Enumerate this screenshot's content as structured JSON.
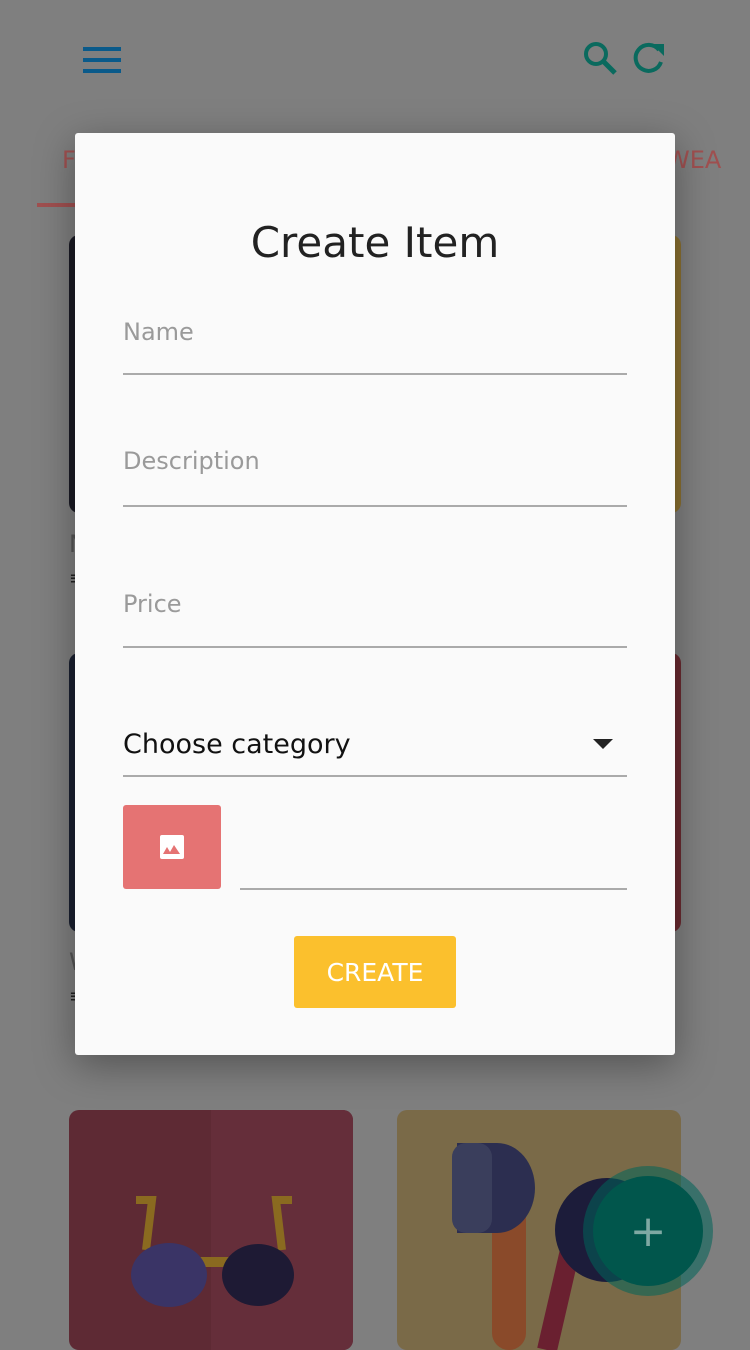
{
  "header": {
    "menu_icon": "hamburger-icon",
    "search_icon": "search-icon",
    "refresh_icon": "refresh-icon"
  },
  "tabs": [
    {
      "label": "F"
    },
    {
      "label": "WEA"
    }
  ],
  "cards": [
    {
      "label": "N"
    },
    {
      "label": "W"
    }
  ],
  "fab": {
    "label": "+"
  },
  "dialog": {
    "title": "Create Item",
    "name_placeholder": "Name",
    "description_placeholder": "Description",
    "price_placeholder": "Price",
    "category_selected": "Choose category",
    "image_icon": "image-icon",
    "create_label": "CREATE"
  },
  "colors": {
    "accent": "#fbc02d",
    "image_button": "#e57373",
    "fab": "#01564c"
  }
}
